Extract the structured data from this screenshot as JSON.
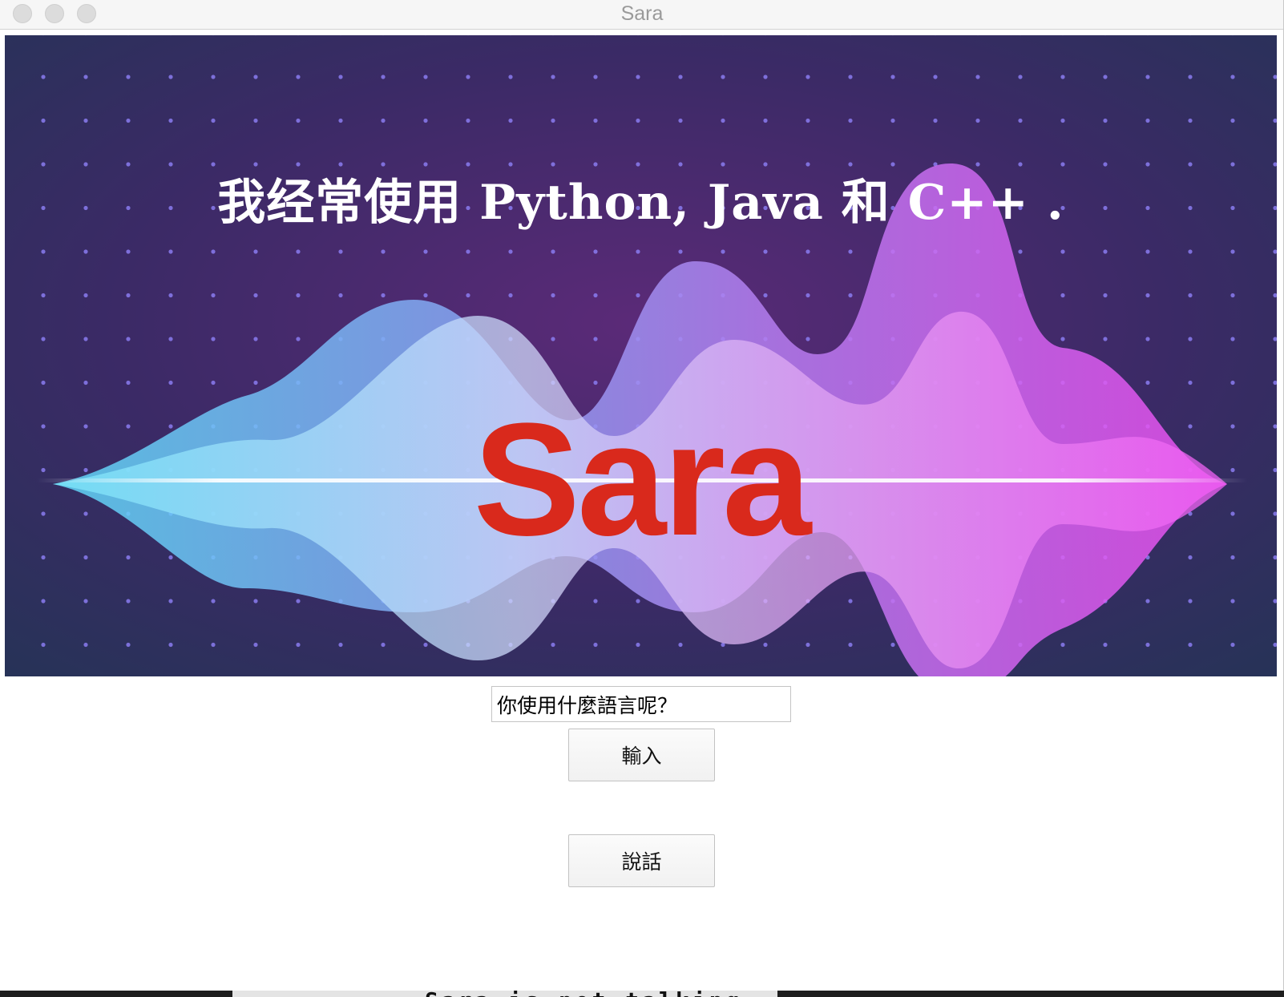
{
  "window": {
    "title": "Sara"
  },
  "banner": {
    "caption": "我经常使用 Python, Java 和 C++ .",
    "logo_text": "Sara",
    "logo_color": "#d9291c"
  },
  "query": {
    "value": "你使用什麼語言呢？"
  },
  "buttons": {
    "enter_label": "輸入",
    "speak_label": "說話"
  },
  "background_terminal": {
    "text": "Sara is not talking"
  }
}
